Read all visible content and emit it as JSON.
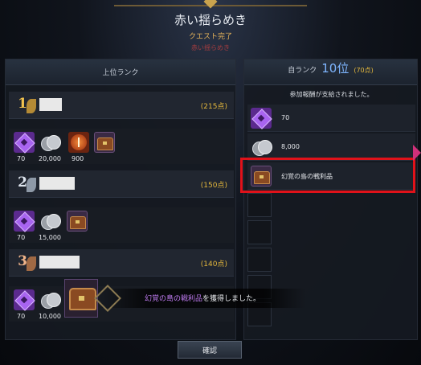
{
  "header": {
    "title": "赤い揺らめき",
    "status": "クエスト完了",
    "sub_status": "赤い揺らめき"
  },
  "left_panel": {
    "heading": "上位ランク",
    "ranks": [
      {
        "rank": "1",
        "points": "(215点)",
        "medal_color": "#d9a437",
        "rewards": [
          {
            "icon": "purple-gem-icon",
            "label": "70"
          },
          {
            "icon": "silver-coins-icon",
            "label": "20,000"
          },
          {
            "icon": "orange-orb-icon",
            "label": "900"
          },
          {
            "icon": "treasure-chest-icon",
            "label": ""
          }
        ]
      },
      {
        "rank": "2",
        "points": "(150点)",
        "medal_color": "#aab6c6",
        "rewards": [
          {
            "icon": "purple-gem-icon",
            "label": "70"
          },
          {
            "icon": "silver-coins-icon",
            "label": "15,000"
          },
          {
            "icon": "treasure-chest-icon",
            "label": ""
          }
        ]
      },
      {
        "rank": "3",
        "points": "(140点)",
        "medal_color": "#c07a4a",
        "rewards": [
          {
            "icon": "purple-gem-icon",
            "label": "70"
          },
          {
            "icon": "silver-coins-icon",
            "label": "10,000"
          }
        ]
      }
    ]
  },
  "right_panel": {
    "self_rank_label": "自ランク",
    "self_rank_value": "10位",
    "self_points": "(70点)",
    "paid_text": "参加報酬が支給されました。",
    "rewards": [
      {
        "icon": "purple-gem-icon",
        "label": "70"
      },
      {
        "icon": "silver-coins-icon",
        "label": "8,000"
      },
      {
        "icon": "treasure-chest-icon",
        "label": "幻覚の島の戦利品"
      }
    ]
  },
  "notification": {
    "item_name": "幻覚の島の戦利品",
    "suffix": "を獲得しました。"
  },
  "confirm_label": "確認"
}
